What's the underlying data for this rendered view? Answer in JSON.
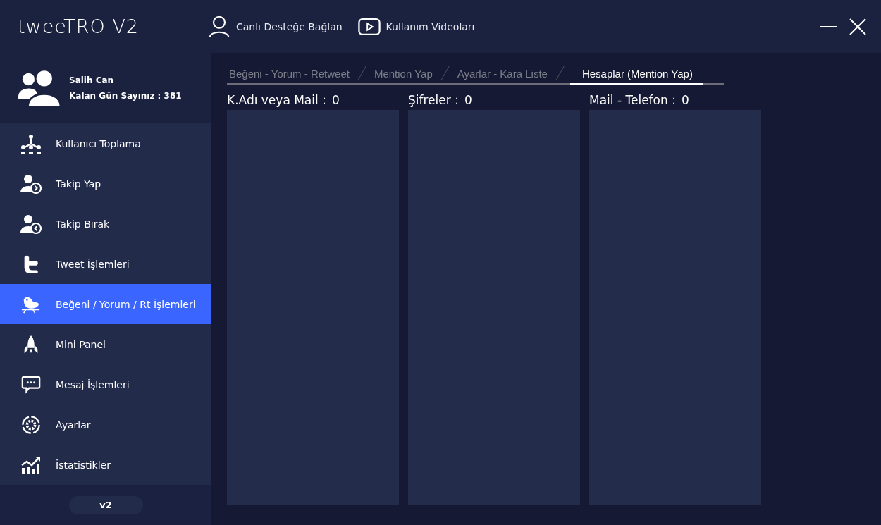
{
  "window": {
    "title": "tweeTRO V2"
  },
  "header_links": [
    {
      "kind": "user",
      "label": "Canlı Desteğe Bağlan"
    },
    {
      "kind": "video",
      "label": "Kullanım Videoları"
    }
  ],
  "profile": {
    "name": "Salih Can",
    "days_label": "Kalan Gün Sayınız : 381"
  },
  "sidebar": {
    "items": [
      {
        "kind": "network",
        "label": "Kullanıcı Toplama",
        "selected": false
      },
      {
        "kind": "follow",
        "label": "Takip Yap",
        "selected": false
      },
      {
        "kind": "unfollow",
        "label": "Takip Bırak",
        "selected": false
      },
      {
        "kind": "tweet",
        "label": "Tweet İşlemleri",
        "selected": false
      },
      {
        "kind": "bird",
        "label": "Beğeni / Yorum / Rt İşlemleri",
        "selected": true
      },
      {
        "kind": "rocket",
        "label": "Mini Panel",
        "selected": false
      },
      {
        "kind": "message",
        "label": "Mesaj İşlemleri",
        "selected": false
      },
      {
        "kind": "gear",
        "label": "Ayarlar",
        "selected": false
      },
      {
        "kind": "chart",
        "label": "İstatistikler",
        "selected": false
      }
    ],
    "version": "v2"
  },
  "tabs": [
    {
      "label": "Beğeni - Yorum - Retweet",
      "selected": false
    },
    {
      "label": "Mention Yap",
      "selected": false
    },
    {
      "label": "Ayarlar - Kara Liste",
      "selected": false
    },
    {
      "label": "Hesaplar (Mention Yap)",
      "selected": true
    }
  ],
  "lists": [
    {
      "label": "K.Adı veya Mail :",
      "count": "0"
    },
    {
      "label": "Şifreler :",
      "count": "0"
    },
    {
      "label": "Mail - Telefon :",
      "count": "0"
    }
  ]
}
